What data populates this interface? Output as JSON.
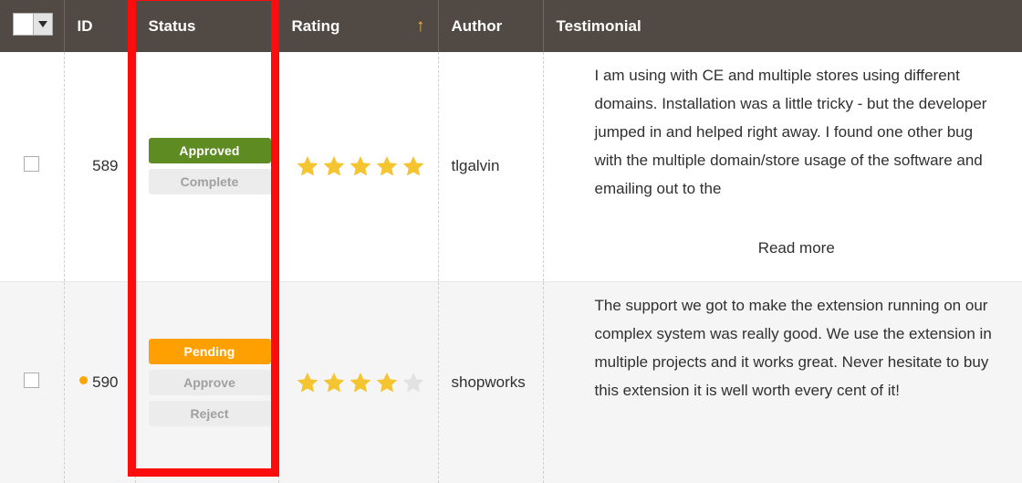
{
  "table": {
    "columns": [
      {
        "key": "select",
        "label": ""
      },
      {
        "key": "id",
        "label": "ID"
      },
      {
        "key": "status",
        "label": "Status"
      },
      {
        "key": "rating",
        "label": "Rating"
      },
      {
        "key": "author",
        "label": "Author"
      },
      {
        "key": "testimonial",
        "label": "Testimonial"
      }
    ],
    "header": {
      "select_all_icon": "checkbox-icon",
      "select_all_dropdown_icon": "chevron-down-icon",
      "sorted_column": "Rating",
      "sort_direction_glyph": "↑",
      "sort_direction": "asc"
    },
    "rows": [
      {
        "id": "589",
        "has_status_dot": false,
        "status_badge": "Approved",
        "status_badge_color": "#5f8b23",
        "actions": [
          "Complete"
        ],
        "rating": 5,
        "rating_max": 5,
        "author": "tlgalvin",
        "testimonial": "I am using with CE and multiple stores using different domains. Installation was a little tricky - but the developer jumped in and helped right away. I found one other bug with the multiple domain/store usage of the software and emailing out to the",
        "read_more_label": "Read more",
        "has_read_more": true
      },
      {
        "id": "590",
        "has_status_dot": true,
        "status_dot_color": "#ffa500",
        "status_badge": "Pending",
        "status_badge_color": "#ffa000",
        "actions": [
          "Approve",
          "Reject"
        ],
        "rating": 4,
        "rating_max": 5,
        "author": "shopworks",
        "testimonial": "The support we got to make the extension running on our complex system was really good. We use the extension in multiple projects and it works great. Never hesitate to buy this extension it is well worth every cent of it!",
        "read_more_label": "",
        "has_read_more": false
      }
    ]
  },
  "annotation": {
    "type": "highlight-rectangle",
    "color": "#fc0d0d",
    "target_column": "Status"
  },
  "colors": {
    "header_background": "#514943",
    "header_text": "#ffffff",
    "row_odd_background": "#ffffff",
    "row_even_background": "#f5f5f5",
    "star_filled": "#f5c431",
    "star_empty": "#e2e2e2",
    "sort_arrow": "#f2b544",
    "body_text": "#303030"
  }
}
